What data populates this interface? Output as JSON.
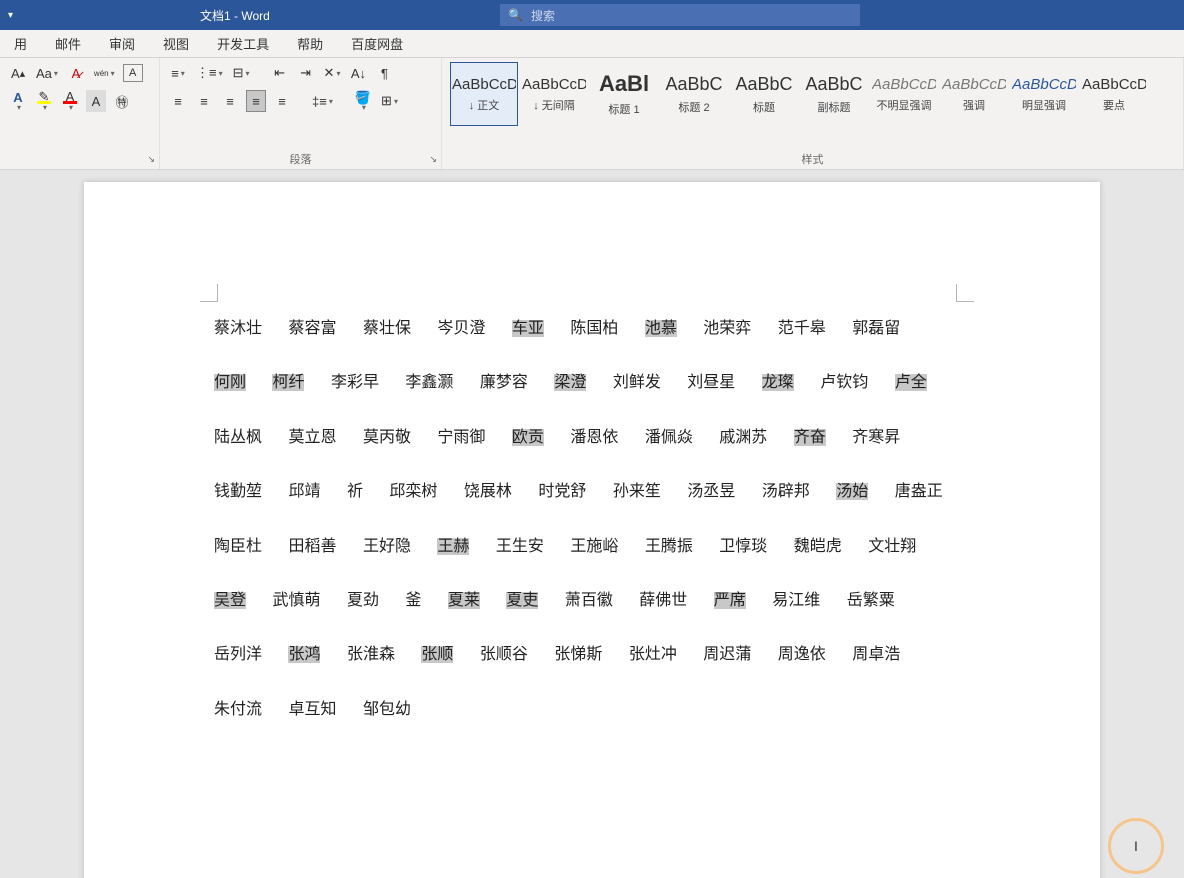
{
  "title": "文档1  -  Word",
  "search_placeholder": "搜索",
  "tabs": [
    "用",
    "邮件",
    "审阅",
    "视图",
    "开发工具",
    "帮助",
    "百度网盘"
  ],
  "ribbon": {
    "font_label": "",
    "para_label": "段落",
    "styles_label": "样式"
  },
  "styles": [
    {
      "preview": "AaBbCcDd",
      "name": "↓ 正文",
      "cls": "",
      "sel": true
    },
    {
      "preview": "AaBbCcDd",
      "name": "↓ 无间隔",
      "cls": ""
    },
    {
      "preview": "AaBl",
      "name": "标题 1",
      "cls": "big"
    },
    {
      "preview": "AaBbC",
      "name": "标题 2",
      "cls": "h"
    },
    {
      "preview": "AaBbC",
      "name": "标题",
      "cls": "h"
    },
    {
      "preview": "AaBbC",
      "name": "副标题",
      "cls": "h"
    },
    {
      "preview": "AaBbCcDd",
      "name": "不明显强调",
      "cls": "italic"
    },
    {
      "preview": "AaBbCcDd",
      "name": "强调",
      "cls": "italic"
    },
    {
      "preview": "AaBbCcDd",
      "name": "明显强调",
      "cls": "blue"
    },
    {
      "preview": "AaBbCcD",
      "name": "要点",
      "cls": ""
    }
  ],
  "names": [
    {
      "t": "蔡沐壮",
      "h": false
    },
    {
      "t": "蔡容富",
      "h": false
    },
    {
      "t": "蔡壮保",
      "h": false
    },
    {
      "t": "岑贝澄",
      "h": false
    },
    {
      "t": "车亚",
      "h": true
    },
    {
      "t": "陈国柏",
      "h": false
    },
    {
      "t": "池慕",
      "h": true
    },
    {
      "t": "池荣弈",
      "h": false
    },
    {
      "t": "范千皋",
      "h": false
    },
    {
      "t": "郭磊留",
      "h": false
    },
    {
      "t": "何刚",
      "h": true
    },
    {
      "t": "柯纤",
      "h": true
    },
    {
      "t": "李彩早",
      "h": false
    },
    {
      "t": "李鑫灏",
      "h": false
    },
    {
      "t": "廉梦容",
      "h": false
    },
    {
      "t": "梁澄",
      "h": true
    },
    {
      "t": "刘鲜发",
      "h": false
    },
    {
      "t": "刘昼星",
      "h": false
    },
    {
      "t": "龙璨",
      "h": true
    },
    {
      "t": "卢钦钧",
      "h": false
    },
    {
      "t": "卢全",
      "h": true
    },
    {
      "t": "陆丛枫",
      "h": false
    },
    {
      "t": "莫立恩",
      "h": false
    },
    {
      "t": "莫丙敬",
      "h": false
    },
    {
      "t": "宁雨御",
      "h": false
    },
    {
      "t": "欧贡",
      "h": true
    },
    {
      "t": "潘恩依",
      "h": false
    },
    {
      "t": "潘佩焱",
      "h": false
    },
    {
      "t": "戚渊苏",
      "h": false
    },
    {
      "t": "齐奋",
      "h": true
    },
    {
      "t": "齐寒昇",
      "h": false
    },
    {
      "t": "钱勤堃",
      "h": false
    },
    {
      "t": "邱靖",
      "h": false
    },
    {
      "t": "祈",
      "h": false
    },
    {
      "t": "邱栾树",
      "h": false
    },
    {
      "t": "饶展林",
      "h": false
    },
    {
      "t": "时党舒",
      "h": false
    },
    {
      "t": "孙来笙",
      "h": false
    },
    {
      "t": "汤丞昱",
      "h": false
    },
    {
      "t": "汤辟邦",
      "h": false
    },
    {
      "t": "汤始",
      "h": true
    },
    {
      "t": "唐盎正",
      "h": false
    },
    {
      "t": "陶臣杜",
      "h": false
    },
    {
      "t": "田稻善",
      "h": false
    },
    {
      "t": "王好隐",
      "h": false
    },
    {
      "t": "王赫",
      "h": true
    },
    {
      "t": "王生安",
      "h": false
    },
    {
      "t": "王施峪",
      "h": false
    },
    {
      "t": "王腾振",
      "h": false
    },
    {
      "t": "卫惇琰",
      "h": false
    },
    {
      "t": "魏皑虎",
      "h": false
    },
    {
      "t": "文壮翔",
      "h": false
    },
    {
      "t": "吴登",
      "h": true
    },
    {
      "t": "武慎萌",
      "h": false
    },
    {
      "t": "夏劲",
      "h": false
    },
    {
      "t": "釜",
      "h": false
    },
    {
      "t": "夏莱",
      "h": true
    },
    {
      "t": "夏吏",
      "h": true
    },
    {
      "t": "萧百徽",
      "h": false
    },
    {
      "t": "薛佛世",
      "h": false
    },
    {
      "t": "严席",
      "h": true
    },
    {
      "t": "易江维",
      "h": false
    },
    {
      "t": "岳繁粟",
      "h": false
    },
    {
      "t": "岳列洋",
      "h": false
    },
    {
      "t": "张鸿",
      "h": true
    },
    {
      "t": "张淮森",
      "h": false
    },
    {
      "t": "张顺",
      "h": true
    },
    {
      "t": "张顺谷",
      "h": false
    },
    {
      "t": "张悌斯",
      "h": false
    },
    {
      "t": "张灶冲",
      "h": false
    },
    {
      "t": "周迟蒲",
      "h": false
    },
    {
      "t": "周逸依",
      "h": false
    },
    {
      "t": "周卓浩",
      "h": false
    },
    {
      "t": "朱付流",
      "h": false
    },
    {
      "t": "卓互知",
      "h": false
    },
    {
      "t": "邹包幼",
      "h": false
    }
  ]
}
